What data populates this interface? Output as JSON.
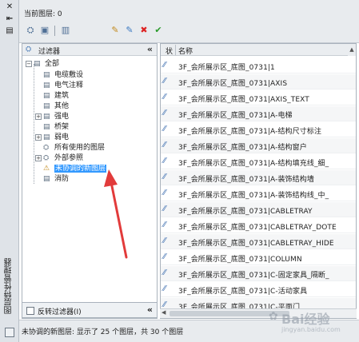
{
  "window": {
    "side_title": "图层特性管理器",
    "side_buttons": [
      "close-icon",
      "autohide-icon",
      "properties-icon"
    ]
  },
  "header": {
    "current_layer_label": "当前图层: 0",
    "toolbar": {
      "new_property_filter": "new-property-filter-icon",
      "new_group_filter": "new-group-filter-icon",
      "layer_states_manager": "layer-states-manager-icon",
      "new_layer": "new-layer-icon",
      "new_layer_vp_frozen": "new-layer-vp-frozen-icon",
      "delete_layer": "delete-layer-icon",
      "set_current": "set-current-icon"
    }
  },
  "filter_panel": {
    "title": "过滤器",
    "tree": {
      "root": "全部",
      "children": [
        "电缆敷设",
        "电气注释",
        "建筑",
        "其他",
        "强电",
        "桥架",
        "弱电",
        "所有使用的图层",
        "外部参照",
        "未协调的新图层",
        "消防"
      ],
      "selected": "未协调的新图层"
    },
    "invert_filter_label": "反转过滤器(I)"
  },
  "layer_list": {
    "columns": [
      "状",
      "名称"
    ],
    "rows": [
      "3F_会所展示区_底图_0731|1",
      "3F_会所展示区_底图_0731|AXIS",
      "3F_会所展示区_底图_0731|AXIS_TEXT",
      "3F_会所展示区_底图_0731|A-电梯",
      "3F_会所展示区_底图_0731|A-结构尺寸标注",
      "3F_会所展示区_底图_0731|A-结构窗户",
      "3F_会所展示区_底图_0731|A-结构填充线_细_",
      "3F_会所展示区_底图_0731|A-装饰结构墙",
      "3F_会所展示区_底图_0731|A-装饰结构线_中_",
      "3F_会所展示区_底图_0731|CABLETRAY",
      "3F_会所展示区_底图_0731|CABLETRAY_DOTE",
      "3F_会所展示区_底图_0731|CABLETRAY_HIDE",
      "3F_会所展示区_底图_0731|COLUMN",
      "3F_会所展示区_底图_0731|C-固定家具_隔断_",
      "3F_会所展示区_底图_0731|C-活动家具",
      "3F_会所展示区_底图_0731|C-平面门"
    ]
  },
  "status_bar": {
    "text": "未协调的新图层: 显示了 25 个图层，共 30 个图层"
  },
  "watermark": {
    "line1": "Bai经验",
    "line2": "jingyan.baidu.com"
  },
  "colors": {
    "selection": "#3399ff",
    "arrow": "#e23b3b",
    "panel_bg": "#e8ebee"
  }
}
